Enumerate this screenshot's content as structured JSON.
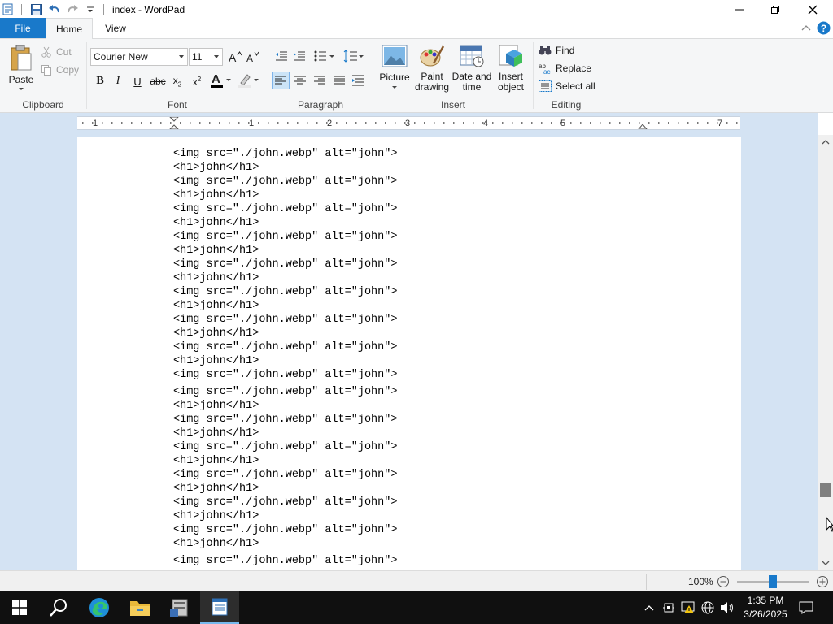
{
  "window": {
    "title": "index - WordPad"
  },
  "tabs": {
    "file": "File",
    "home": "Home",
    "view": "View"
  },
  "clipboard": {
    "paste": "Paste",
    "cut": "Cut",
    "copy": "Copy",
    "label": "Clipboard"
  },
  "font": {
    "family": "Courier New",
    "size": "11",
    "label": "Font"
  },
  "paragraph": {
    "label": "Paragraph"
  },
  "insert": {
    "picture": "Picture",
    "paint_line1": "Paint",
    "paint_line2": "drawing",
    "datetime_line1": "Date and",
    "datetime_line2": "time",
    "object_line1": "Insert",
    "object_line2": "object",
    "label": "Insert"
  },
  "editing": {
    "find": "Find",
    "replace": "Replace",
    "select_all": "Select all",
    "label": "Editing"
  },
  "ruler": {
    "marks": [
      "1",
      "1",
      "2",
      "3",
      "4",
      "5",
      "7"
    ]
  },
  "document": {
    "lines": [
      "<img src=\"./john.webp\" alt=\"john\">",
      "<h1>john</h1>",
      "<img src=\"./john.webp\" alt=\"john\">",
      "<h1>john</h1>",
      "<img src=\"./john.webp\" alt=\"john\">",
      "<h1>john</h1>",
      "<img src=\"./john.webp\" alt=\"john\">",
      "<h1>john</h1>",
      "<img src=\"./john.webp\" alt=\"john\">",
      "<h1>john</h1>",
      "<img src=\"./john.webp\" alt=\"john\">",
      "<h1>john</h1>",
      "<img src=\"./john.webp\" alt=\"john\">",
      "<h1>john</h1>",
      "<img src=\"./john.webp\" alt=\"john\">",
      "<h1>john</h1>",
      "<img src=\"./john.webp\" alt=\"john\">",
      "",
      "<img src=\"./john.webp\" alt=\"john\">",
      "<h1>john</h1>",
      "<img src=\"./john.webp\" alt=\"john\">",
      "<h1>john</h1>",
      "<img src=\"./john.webp\" alt=\"john\">",
      "<h1>john</h1>",
      "<img src=\"./john.webp\" alt=\"john\">",
      "<h1>john</h1>",
      "<img src=\"./john.webp\" alt=\"john\">",
      "<h1>john</h1>",
      "<img src=\"./john.webp\" alt=\"john\">",
      "<h1>john</h1>",
      "",
      "<img src=\"./john.webp\" alt=\"john\">"
    ]
  },
  "status": {
    "zoom": "100%"
  },
  "taskbar": {
    "time": "1:35 PM",
    "date": "3/26/2025"
  },
  "colors": {
    "accent": "#1979ca",
    "doc_background": "#d4e3f3",
    "ribbon_background": "#f5f6f7",
    "taskbar": "#101010"
  }
}
